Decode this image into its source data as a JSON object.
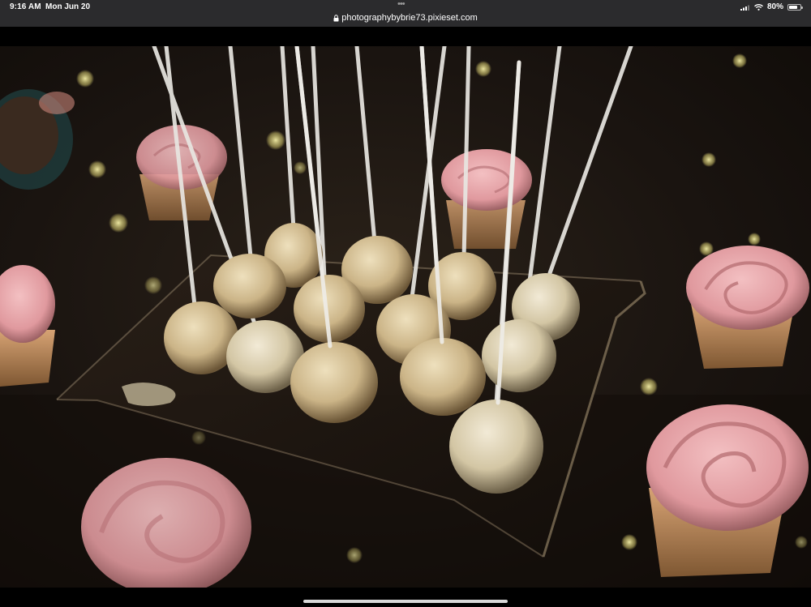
{
  "status_bar": {
    "time": "9:16 AM",
    "date": "Mon Jun 20",
    "url": "photographybybrie73.pixieset.com",
    "battery_percent": "80%",
    "battery_level": 0.8,
    "icons": [
      "signal-icon",
      "wifi-icon",
      "battery-icon",
      "lock-icon",
      "more-dots-icon"
    ]
  },
  "photo": {
    "subject": "cake-pops-and-cupcakes-photo"
  },
  "colors": {
    "status_bar_bg": "#2b2b2d",
    "frosting_pink": "#e49aa0",
    "cake_pop_cream": "#d6c49a",
    "tray_dark": "#1c140e"
  }
}
